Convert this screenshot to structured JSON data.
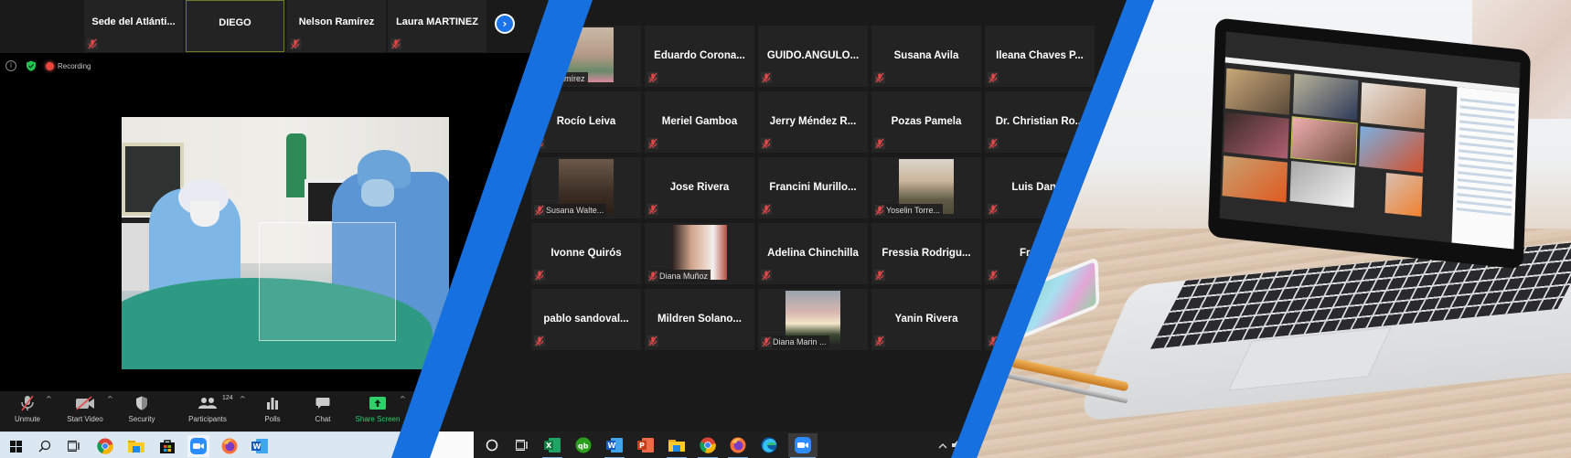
{
  "left_meeting": {
    "strip_tiles": [
      {
        "name": "Sede del Atlánti...",
        "muted": true,
        "active": false
      },
      {
        "name": "DIEGO",
        "muted": false,
        "active": true
      },
      {
        "name": "Nelson Ramírez",
        "muted": true,
        "active": false
      },
      {
        "name": "Laura MARTINEZ",
        "muted": true,
        "active": false
      }
    ],
    "next_page_icon": "chevron-right-icon",
    "info_bar": {
      "recording_label": "Recording"
    },
    "main_video": {
      "description": "Medical team performing intubation with acrylic box"
    },
    "toolbar": {
      "unmute": "Unmute",
      "start_video": "Start Video",
      "security": "Security",
      "participants": "Participants",
      "participants_count": "124",
      "polls": "Polls",
      "chat": "Chat",
      "share_screen": "Share Screen"
    },
    "taskbar": [
      "windows-start",
      "search",
      "task-view",
      "chrome",
      "file-explorer",
      "microsoft-store",
      "zoom",
      "firefox",
      "word"
    ]
  },
  "gallery": {
    "tiles": [
      {
        "name": "...ay Ramírez",
        "photo": "av-woman1",
        "muted": false
      },
      {
        "name": "Eduardo  Corona...",
        "photo": null,
        "muted": true
      },
      {
        "name": "GUIDO.ANGULO...",
        "photo": null,
        "muted": true
      },
      {
        "name": "Susana Avila",
        "photo": null,
        "muted": true
      },
      {
        "name": "Ileana  Chaves  P...",
        "photo": null,
        "muted": true
      },
      {
        "name": "Rocío Leiva",
        "photo": null,
        "muted": true
      },
      {
        "name": "Meriel Gamboa",
        "photo": null,
        "muted": true
      },
      {
        "name": "Jerry  Méndez  R...",
        "photo": null,
        "muted": true
      },
      {
        "name": "Pozas Pamela",
        "photo": null,
        "muted": true
      },
      {
        "name": "Dr.  Christian  Ro...",
        "photo": null,
        "muted": true
      },
      {
        "name": "Susana Walte...",
        "photo": "av-hat",
        "muted": true
      },
      {
        "name": "Jose Rivera",
        "photo": null,
        "muted": true
      },
      {
        "name": "Francini  Murillo...",
        "photo": null,
        "muted": true
      },
      {
        "name": "Yoselin Torre...",
        "photo": "av-blonde",
        "muted": true
      },
      {
        "name": "Luis  Daniel",
        "photo": null,
        "muted": true
      },
      {
        "name": "Ivonne Quirós",
        "photo": null,
        "muted": true
      },
      {
        "name": "Diana Muñoz",
        "photo": "av-diana",
        "muted": true
      },
      {
        "name": "Adelina Chinchilla",
        "photo": null,
        "muted": true
      },
      {
        "name": "Fressia  Rodrigu...",
        "photo": null,
        "muted": true
      },
      {
        "name": "Franci...",
        "photo": null,
        "muted": true
      },
      {
        "name": "pablo  sandoval...",
        "photo": null,
        "muted": true
      },
      {
        "name": "Mildren  Solano...",
        "photo": null,
        "muted": true
      },
      {
        "name": "Diana Marin ...",
        "photo": "av-sky",
        "muted": true
      },
      {
        "name": "Yanin Rivera",
        "photo": null,
        "muted": true
      },
      {
        "name": "",
        "photo": null,
        "muted": true
      }
    ],
    "taskbar": [
      "cortana",
      "task-view",
      "excel",
      "quickbooks",
      "word",
      "powerpoint",
      "file-explorer",
      "chrome",
      "firefox",
      "edge",
      "zoom"
    ],
    "tray": [
      "chevron-up",
      "volume"
    ]
  },
  "photo": {
    "description": "Laptop on wooden desk showing a Zoom meeting with phone and pens"
  },
  "colors": {
    "band_blue": "#1670e0",
    "zoom_bg": "#1a1a1a",
    "tile_bg": "#232323",
    "mic_off_red": "#e0484a",
    "share_green": "#2fd06a",
    "zoom_blue": "#1a73e8"
  }
}
